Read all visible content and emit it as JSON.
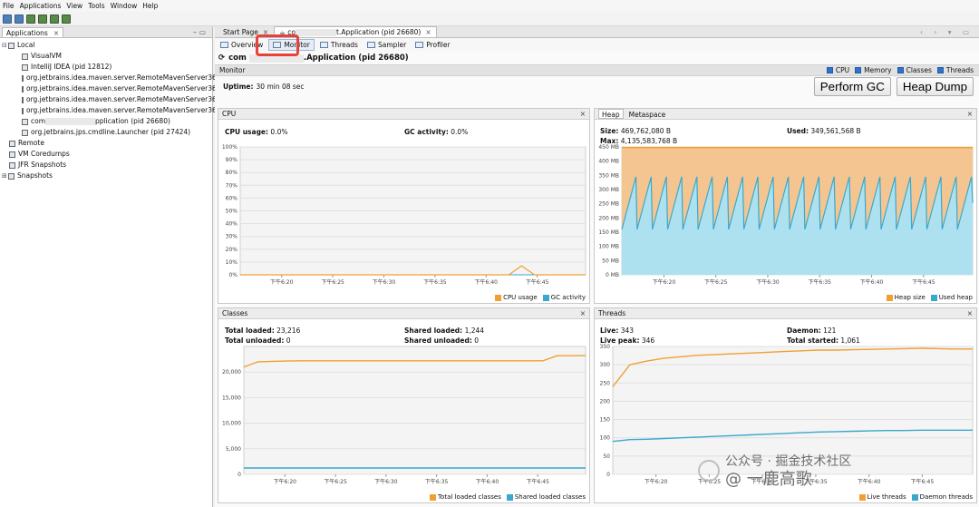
{
  "menu": [
    "File",
    "Applications",
    "View",
    "Tools",
    "Window",
    "Help"
  ],
  "left_panel": {
    "tab_label": "Applications",
    "tab_close": "×",
    "tree": [
      {
        "indent": 0,
        "toggle": "⊟",
        "label": "Local",
        "icon": "computer-icon"
      },
      {
        "indent": 1,
        "label": "VisualVM",
        "icon": "visualvm-icon"
      },
      {
        "indent": 1,
        "label": "IntelliJ IDEA (pid 12812)",
        "icon": "java-app-icon"
      },
      {
        "indent": 1,
        "label": "org.jetbrains.idea.maven.server.RemoteMavenServer36 (pid 2",
        "icon": "java-app-icon"
      },
      {
        "indent": 1,
        "label": "org.jetbrains.idea.maven.server.RemoteMavenServer36 (pid 2",
        "icon": "java-app-icon"
      },
      {
        "indent": 1,
        "label": "org.jetbrains.idea.maven.server.RemoteMavenServer36 (pid 2",
        "icon": "java-app-icon"
      },
      {
        "indent": 1,
        "label": "org.jetbrains.idea.maven.server.RemoteMavenServer36 (pid 3",
        "icon": "java-app-icon"
      },
      {
        "indent": 1,
        "label": "com",
        "label_suffix": "pplication (pid 26680)",
        "icon": "java-app-icon",
        "blurred": true
      },
      {
        "indent": 1,
        "label": "org.jetbrains.jps.cmdline.Launcher (pid 27424)",
        "icon": "java-app-icon"
      },
      {
        "indent": 0,
        "label": "Remote",
        "icon": "remote-icon"
      },
      {
        "indent": 0,
        "label": "VM Coredumps",
        "icon": "coredump-icon"
      },
      {
        "indent": 0,
        "label": "JFR Snapshots",
        "icon": "jfr-icon"
      },
      {
        "indent": 0,
        "toggle": "⊞",
        "label": "Snapshots",
        "icon": "snapshot-icon"
      }
    ]
  },
  "doc_tabs": [
    {
      "label": "Start Page",
      "close": "×"
    },
    {
      "label_prefix": "co",
      "label": "t.Application (pid 26680)",
      "close": "×"
    }
  ],
  "doc_ctrl": "‹ › ▾ ▭",
  "subtabs": [
    "Overview",
    "Monitor",
    "Threads",
    "Sampler",
    "Profiler"
  ],
  "app_title_prefix": "com",
  "app_title_suffix": ".Application (pid 26680)",
  "monitor": {
    "title": "Monitor",
    "checkboxes": [
      "CPU",
      "Memory",
      "Classes",
      "Threads"
    ],
    "uptime_label": "Uptime:",
    "uptime_value": "30 min 08 sec",
    "perform_gc": "Perform GC",
    "heap_dump": "Heap Dump"
  },
  "cpu": {
    "title": "CPU",
    "usage_label": "CPU usage:",
    "usage_value": "0.0%",
    "gc_label": "GC activity:",
    "gc_value": "0.0%",
    "legend": [
      "CPU usage",
      "GC activity"
    ]
  },
  "heap": {
    "tabs": [
      "Heap",
      "Metaspace"
    ],
    "size_label": "Size:",
    "size_value": "469,762,080 B",
    "used_label": "Used:",
    "used_value": "349,561,568 B",
    "max_label": "Max:",
    "max_value": "4,135,583,768 B",
    "legend": [
      "Heap size",
      "Used heap"
    ]
  },
  "classes": {
    "title": "Classes",
    "total_loaded_label": "Total loaded:",
    "total_loaded_value": "23,216",
    "shared_loaded_label": "Shared loaded:",
    "shared_loaded_value": "1,244",
    "total_unloaded_label": "Total unloaded:",
    "total_unloaded_value": "0",
    "shared_unloaded_label": "Shared unloaded:",
    "shared_unloaded_value": "0",
    "legend": [
      "Total loaded classes",
      "Shared loaded classes"
    ]
  },
  "threads": {
    "title": "Threads",
    "live_label": "Live:",
    "live_value": "343",
    "daemon_label": "Daemon:",
    "daemon_value": "121",
    "peak_label": "Live peak:",
    "peak_value": "346",
    "started_label": "Total started:",
    "started_value": "1,061",
    "legend": [
      "Live threads",
      "Daemon threads"
    ]
  },
  "colors": {
    "orange": "#f0a030",
    "blue": "#3aa8cc",
    "heap_fill": "#f4c590",
    "used_fill": "#aee1f0"
  },
  "watermark": "@ 一鹿高歌",
  "watermark_line2": "公众号 · 掘金技术社区",
  "chart_data": [
    {
      "type": "line",
      "title": "CPU",
      "x": [
        "下午6:20",
        "下午6:25",
        "下午6:30",
        "下午6:35",
        "下午6:40",
        "下午6:45"
      ],
      "ylim": [
        0,
        100
      ],
      "yticks": [
        "0%",
        "10%",
        "20%",
        "30%",
        "40%",
        "50%",
        "60%",
        "70%",
        "80%",
        "90%",
        "100%"
      ],
      "series": [
        {
          "name": "CPU usage",
          "values": [
            0,
            0,
            0,
            0,
            0,
            0,
            0,
            0,
            0,
            0,
            0,
            0,
            0,
            0,
            0,
            0,
            0,
            0,
            0,
            0,
            0,
            0,
            7,
            0,
            0,
            0,
            0,
            0
          ]
        },
        {
          "name": "GC activity",
          "values": [
            0,
            0,
            0,
            0,
            0,
            0,
            0,
            0,
            0,
            0,
            0,
            0,
            0,
            0,
            0,
            0,
            0,
            0,
            0,
            0,
            0,
            0,
            0,
            0,
            0,
            0,
            0,
            0
          ]
        }
      ]
    },
    {
      "type": "area",
      "title": "Heap",
      "x": [
        "下午6:20",
        "下午6:25",
        "下午6:30",
        "下午6:35",
        "下午6:40",
        "下午6:45"
      ],
      "ylim": [
        0,
        450
      ],
      "yticks": [
        "0 MB",
        "50 MB",
        "100 MB",
        "150 MB",
        "200 MB",
        "250 MB",
        "300 MB",
        "350 MB",
        "400 MB",
        "450 MB"
      ],
      "series": [
        {
          "name": "Heap size",
          "values": [
            448
          ]
        },
        {
          "name": "Used heap",
          "sawtooth": {
            "low": 160,
            "high": 345,
            "cycles": 23
          }
        }
      ]
    },
    {
      "type": "line",
      "title": "Classes",
      "x": [
        "下午6:20",
        "下午6:25",
        "下午6:30",
        "下午6:35",
        "下午6:40",
        "下午6:45"
      ],
      "ylim": [
        0,
        25000
      ],
      "yticks": [
        "0",
        "5,000",
        "10,000",
        "15,000",
        "20,000"
      ],
      "series": [
        {
          "name": "Total loaded classes",
          "values": [
            21000,
            22000,
            22100,
            22150,
            22200,
            22200,
            22200,
            22200,
            22200,
            22200,
            22200,
            22200,
            22200,
            22200,
            22200,
            22200,
            22200,
            22200,
            22200,
            22200,
            22200,
            22200,
            23200,
            23200,
            23216
          ]
        },
        {
          "name": "Shared loaded classes",
          "values": [
            1244,
            1244
          ]
        }
      ]
    },
    {
      "type": "line",
      "title": "Threads",
      "x": [
        "下午6:20",
        "下午6:25",
        "下午6:30",
        "下午6:35",
        "下午6:40",
        "下午6:45"
      ],
      "ylim": [
        0,
        350
      ],
      "yticks": [
        "0",
        "50",
        "100",
        "150",
        "200",
        "250",
        "300",
        "350"
      ],
      "series": [
        {
          "name": "Live threads",
          "values": [
            240,
            300,
            310,
            318,
            322,
            326,
            328,
            330,
            332,
            334,
            336,
            338,
            340,
            340,
            341,
            342,
            343,
            344,
            345,
            344,
            343,
            343
          ]
        },
        {
          "name": "Daemon threads",
          "values": [
            90,
            95,
            96,
            98,
            100,
            102,
            104,
            106,
            108,
            110,
            112,
            114,
            116,
            117,
            118,
            119,
            120,
            120,
            121,
            121,
            121,
            121
          ]
        }
      ]
    }
  ]
}
